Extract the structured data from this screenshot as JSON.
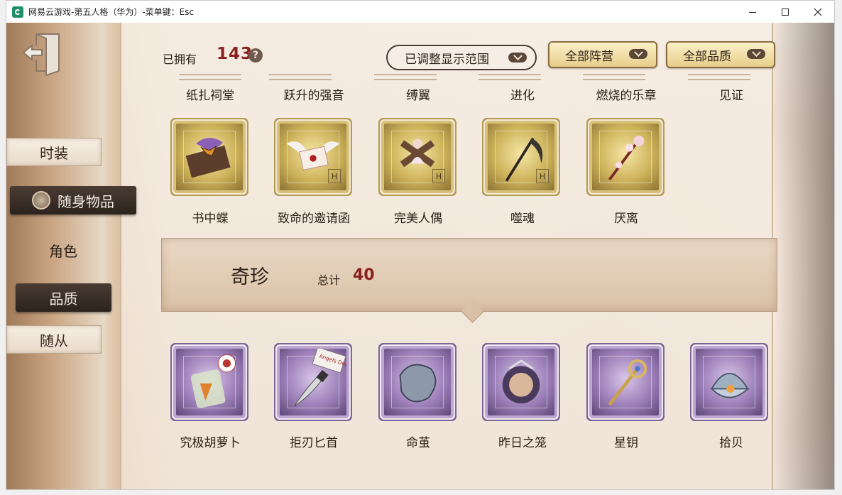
{
  "window": {
    "title": "网易云游戏-第五人格（华为）-菜单键：Esc"
  },
  "sidebar": {
    "tabs": [
      {
        "label": "时装"
      },
      {
        "label": "随身物品"
      },
      {
        "label": "角色"
      },
      {
        "label": "品质"
      },
      {
        "label": "随从"
      }
    ]
  },
  "header": {
    "owned_label": "已拥有",
    "owned_count": "143",
    "help_glyph": "?",
    "range_dropdown": "已调整显示范围",
    "camp_dropdown": "全部阵营",
    "quality_dropdown": "全部品质"
  },
  "top_row_labels": [
    "纸扎祠堂",
    "跃升的强音",
    "缚翼",
    "进化",
    "燃烧的乐章",
    "见证"
  ],
  "gold_items": [
    {
      "name": "书中蝶",
      "icon": "butterfly-book-icon"
    },
    {
      "name": "致命的邀请函",
      "icon": "winged-letter-icon"
    },
    {
      "name": "完美人偶",
      "icon": "doll-cross-icon"
    },
    {
      "name": "噬魂",
      "icon": "scythe-icon"
    },
    {
      "name": "厌离",
      "icon": "floral-staff-icon"
    }
  ],
  "category": {
    "title": "奇珍",
    "total_label": "总计",
    "total": "40"
  },
  "purple_items": [
    {
      "name": "究极胡萝卜",
      "icon": "carrot-jar-icon"
    },
    {
      "name": "拒刃匕首",
      "icon": "dagger-sign-icon",
      "sign_text": "Angels Death"
    },
    {
      "name": "命茧",
      "icon": "cocoon-icon"
    },
    {
      "name": "昨日之笼",
      "icon": "cage-icon"
    },
    {
      "name": "星钥",
      "icon": "star-key-icon"
    },
    {
      "name": "拾贝",
      "icon": "shell-pearl-icon"
    }
  ],
  "colors": {
    "accent_red": "#8a2020",
    "gold_stamp": "#cdb25a",
    "purple_stamp": "#9c7fb8",
    "dark_tab": "#2c231d"
  }
}
